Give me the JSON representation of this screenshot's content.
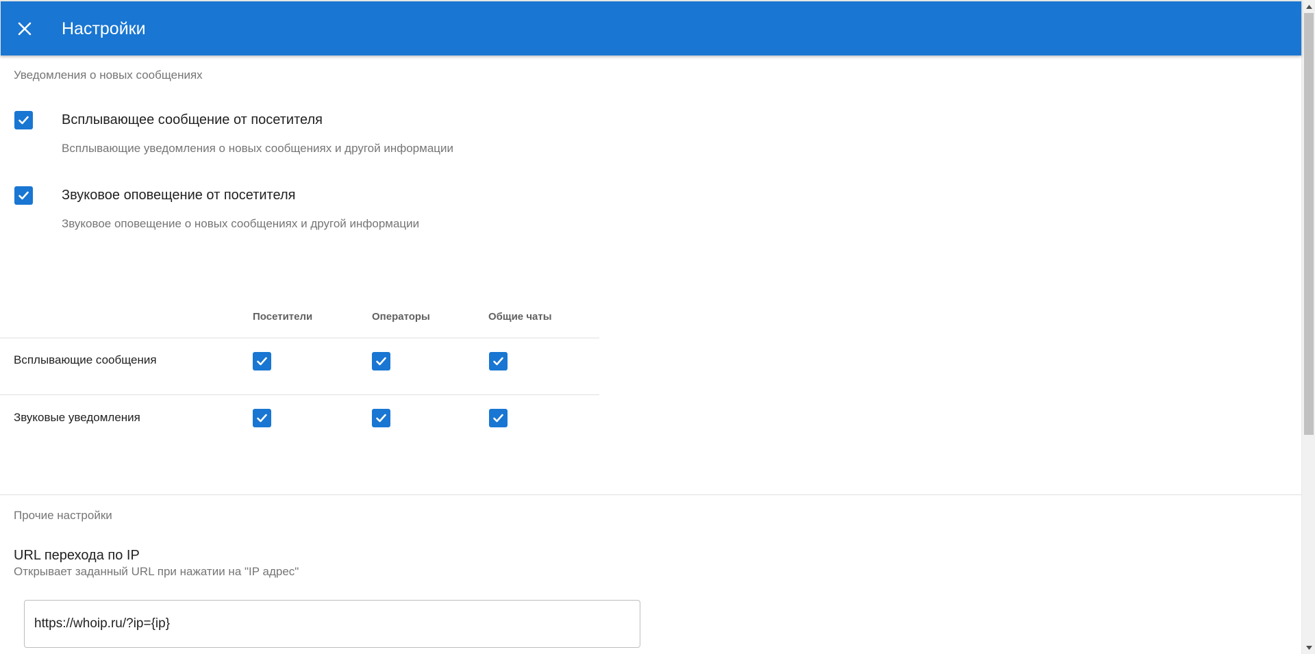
{
  "toolbar": {
    "title": "Настройки",
    "close_icon": "close-icon"
  },
  "notifications": {
    "section_title": "Уведомления о новых сообщениях",
    "options": [
      {
        "title": "Всплывающее сообщение от посетителя",
        "description": "Всплывающие уведомления о новых сообщениях и другой информации",
        "checked": true
      },
      {
        "title": "Звуковое оповещение от посетителя",
        "description": "Звуковое оповещение о новых сообщениях и другой информации",
        "checked": true
      }
    ]
  },
  "matrix": {
    "columns": [
      "Посетители",
      "Операторы",
      "Общие чаты"
    ],
    "rows": [
      {
        "label": "Всплывающие сообщения",
        "values": [
          true,
          true,
          true
        ]
      },
      {
        "label": "Звуковые уведомления",
        "values": [
          true,
          true,
          true
        ]
      }
    ]
  },
  "other": {
    "section_title": "Прочие настройки",
    "url_field": {
      "title": "URL перехода по IP",
      "description": "Открывает заданный URL при нажатии на \"IP адрес\"",
      "value": "https://whoip.ru/?ip={ip}"
    }
  },
  "colors": {
    "accent": "#1976d2",
    "muted_text": "#757575",
    "divider": "#e0e0e0"
  }
}
